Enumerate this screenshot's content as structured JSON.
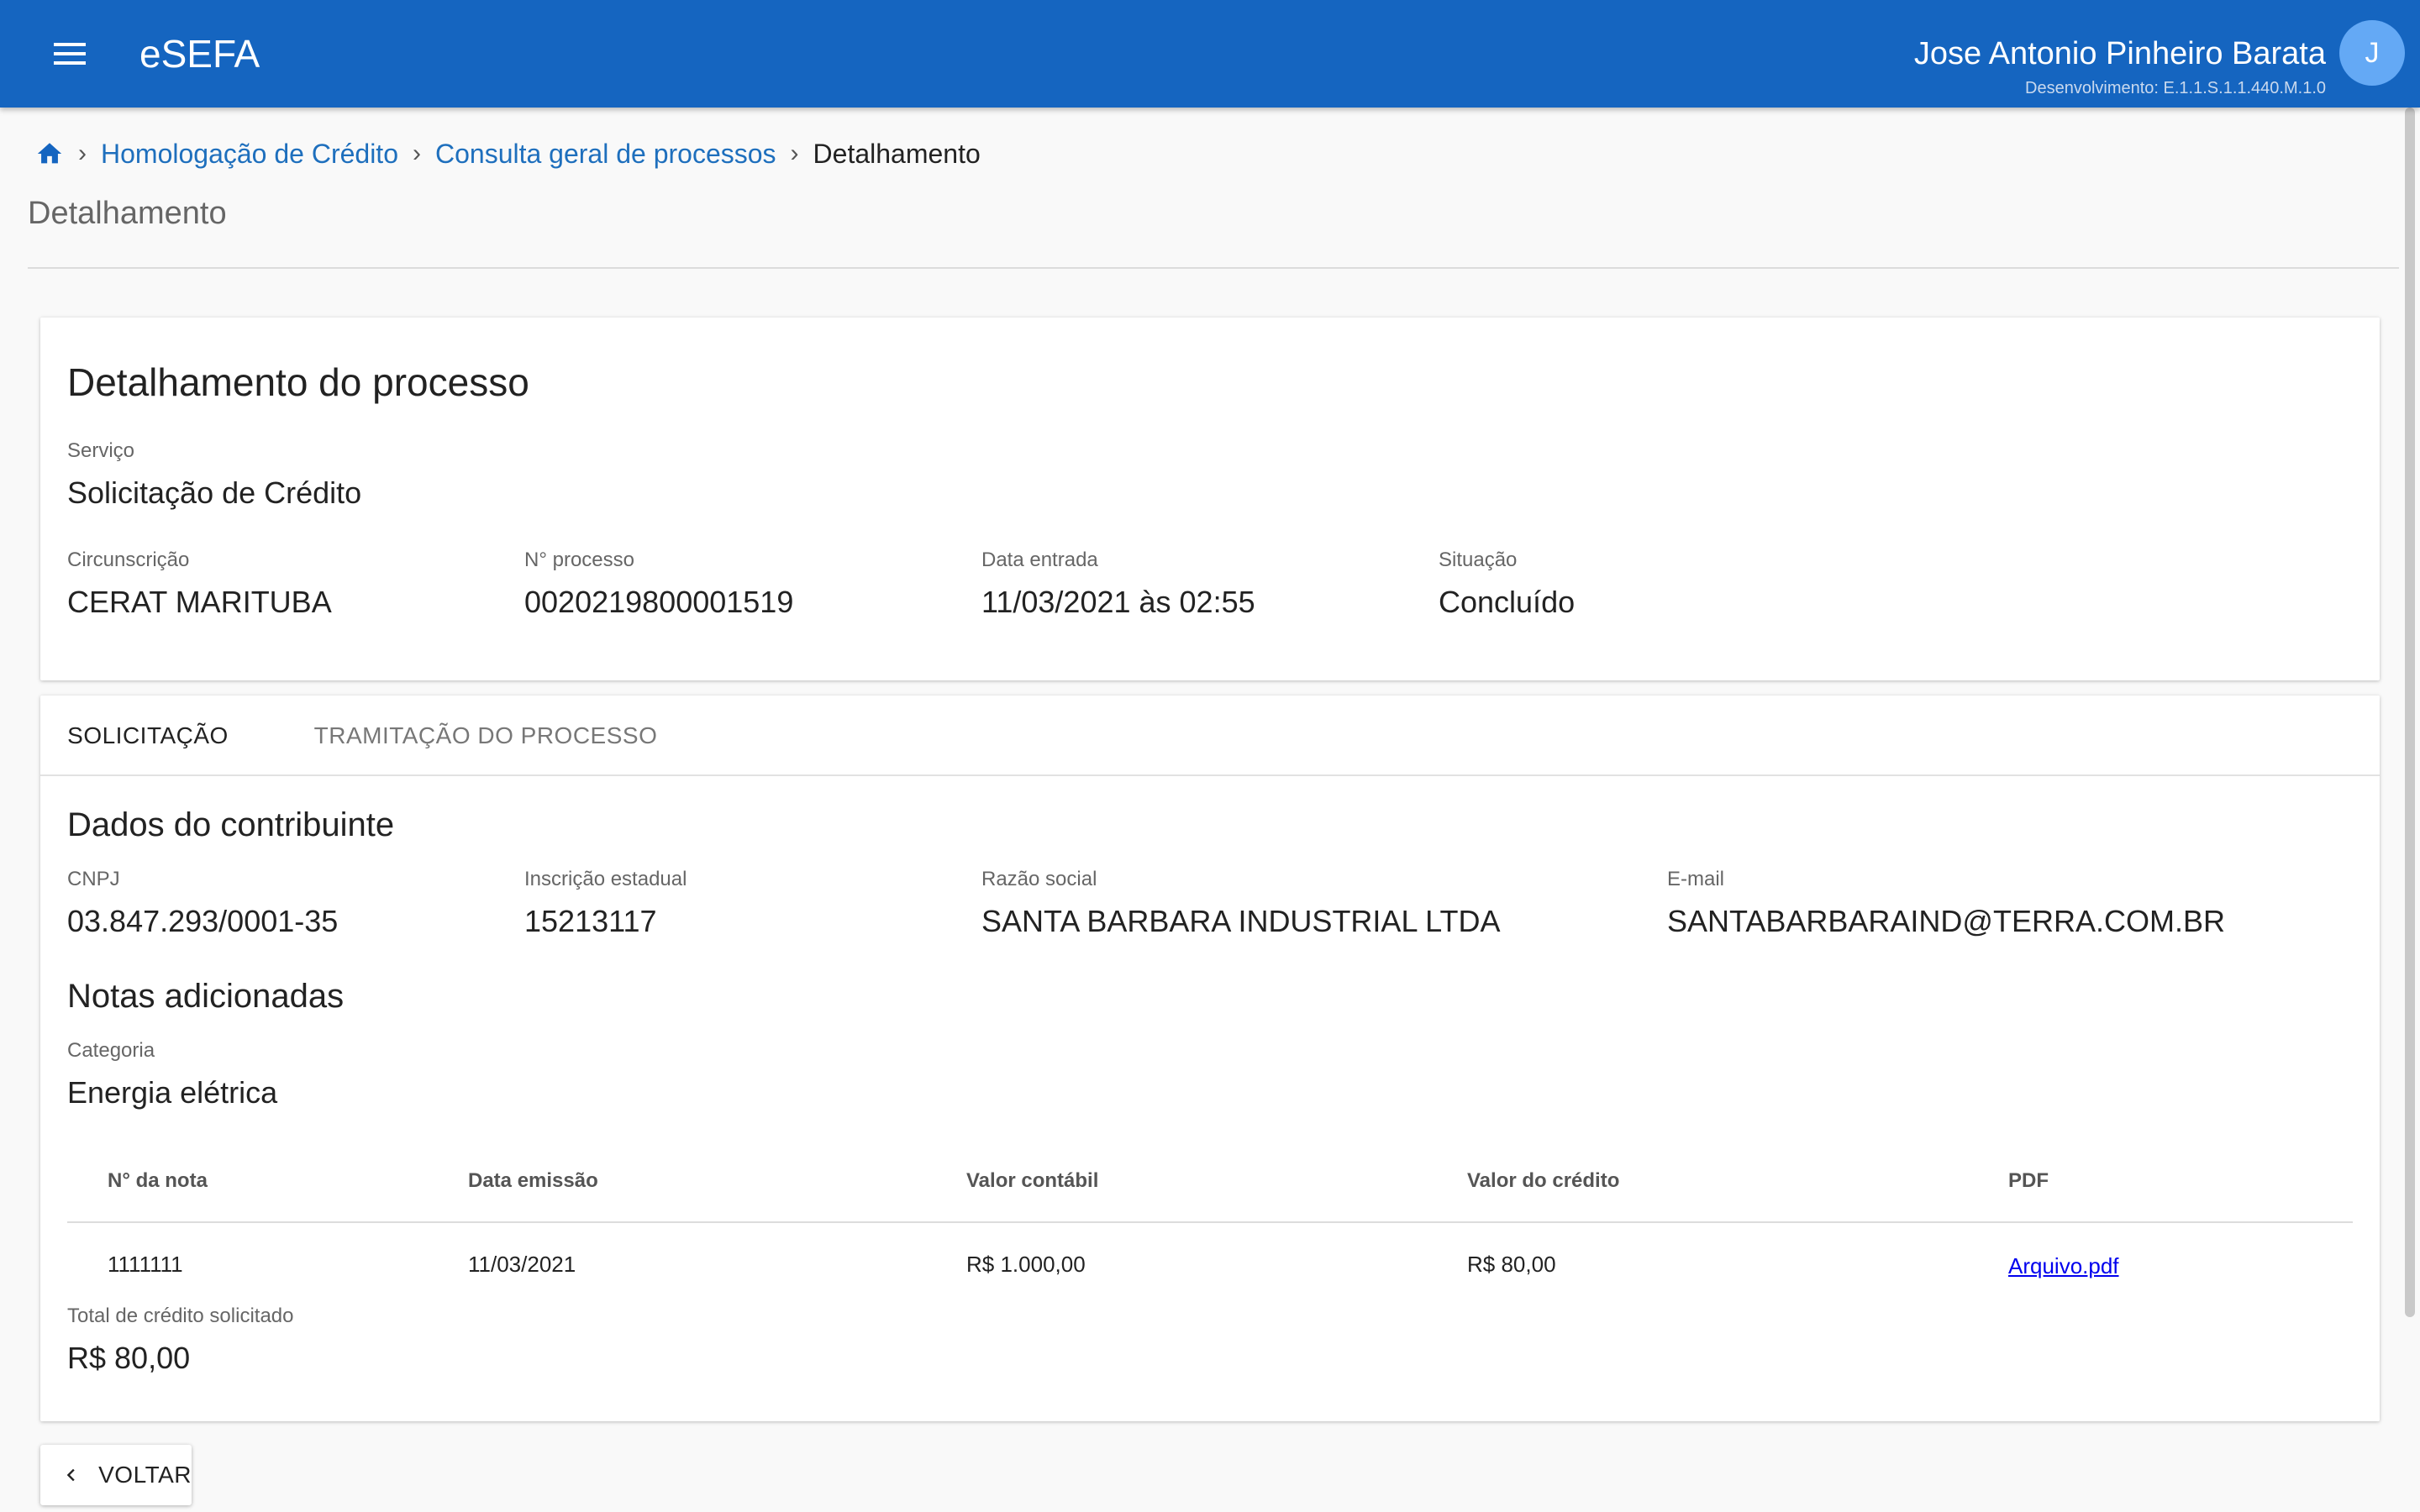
{
  "header": {
    "app_title": "eSEFA",
    "user_name": "Jose Antonio Pinheiro Barata",
    "environment": "Desenvolvimento: E.1.1.S.1.1.440.M.1.0",
    "avatar_initial": "J",
    "menu_icon": "menu-icon"
  },
  "breadcrumb": {
    "home_icon": "home-icon",
    "items": [
      "Homologação de Crédito",
      "Consulta geral de processos"
    ],
    "current": "Detalhamento"
  },
  "page_title": "Detalhamento",
  "process": {
    "title": "Detalhamento do processo",
    "servico_label": "Serviço",
    "servico_value": "Solicitação de Crédito",
    "circunscricao_label": "Circunscrição",
    "circunscricao_value": "CERAT MARITUBA",
    "numero_label": "N° processo",
    "numero_value": "0020219800001519",
    "data_label": "Data entrada",
    "data_value": "11/03/2021 às 02:55",
    "situacao_label": "Situação",
    "situacao_value": "Concluído"
  },
  "tabs": [
    {
      "label": "SOLICITAÇÃO",
      "active": true
    },
    {
      "label": "TRAMITAÇÃO DO PROCESSO",
      "active": false
    }
  ],
  "contribuinte": {
    "title": "Dados do contribuinte",
    "cnpj_label": "CNPJ",
    "cnpj_value": "03.847.293/0001-35",
    "ie_label": "Inscrição estadual",
    "ie_value": "15213117",
    "razao_label": "Razão social",
    "razao_value": "SANTA BARBARA INDUSTRIAL LTDA",
    "email_label": "E-mail",
    "email_value": "SANTABARBARAIND@TERRA.COM.BR"
  },
  "notas": {
    "title": "Notas adicionadas",
    "categoria_label": "Categoria",
    "categoria_value": "Energia elétrica",
    "columns": [
      "N° da nota",
      "Data emissão",
      "Valor contábil",
      "Valor do crédito",
      "PDF"
    ],
    "rows": [
      [
        "1111111",
        "11/03/2021",
        "R$ 1.000,00",
        "R$ 80,00",
        "Arquivo.pdf"
      ]
    ],
    "total_label": "Total de crédito solicitado",
    "total_value": "R$ 80,00"
  },
  "back_button": {
    "label": "VOLTAR",
    "icon": "chevron-left-icon"
  },
  "colors": {
    "header_bg": "#1565c0",
    "avatar_bg": "#64a9f5",
    "link": "#1e6fbd"
  }
}
